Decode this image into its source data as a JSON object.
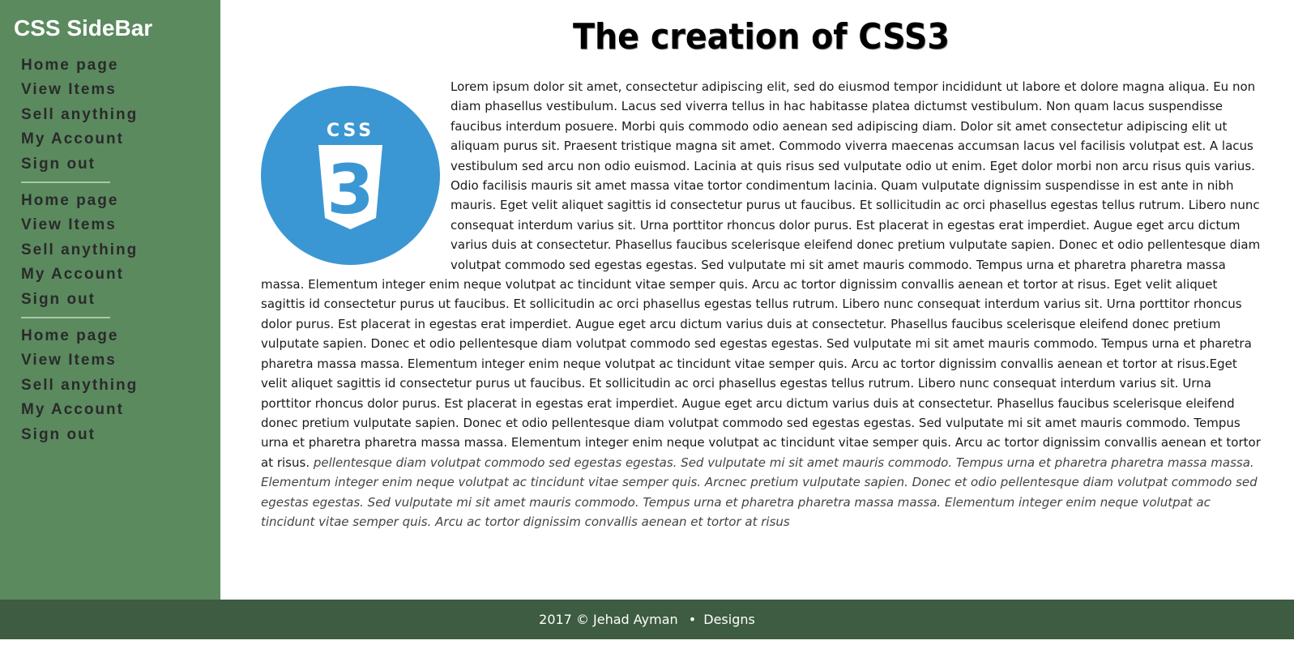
{
  "sidebar": {
    "brand": "CSS SideBar",
    "groups": [
      {
        "items": [
          "Home page",
          "View Items",
          "Sell anything",
          "My Account",
          "Sign out"
        ]
      },
      {
        "items": [
          "Home page",
          "View Items",
          "Sell anything",
          "My Account",
          "Sign out"
        ]
      },
      {
        "items": [
          "Home page",
          "View Items",
          "Sell anything",
          "My Account",
          "Sign out"
        ]
      }
    ],
    "colors": {
      "background": "#5b8a5f",
      "divider": "#a8c8a6"
    }
  },
  "main": {
    "title": "The creation of CSS3",
    "logo": {
      "icon": "css3-logo-icon",
      "label": "CSS",
      "digit": "3",
      "color": "#3b97d3"
    },
    "paragraph": "Lorem ipsum dolor sit amet, consectetur adipiscing elit, sed do eiusmod tempor incididunt ut labore et dolore magna aliqua. Eu non diam phasellus vestibulum. Lacus sed viverra tellus in hac habitasse platea dictumst vestibulum. Non quam lacus suspendisse faucibus interdum posuere. Morbi quis commodo odio aenean sed adipiscing diam. Dolor sit amet consectetur adipiscing elit ut aliquam purus sit. Praesent tristique magna sit amet. Commodo viverra maecenas accumsan lacus vel facilisis volutpat est. A lacus vestibulum sed arcu non odio euismod. Lacinia at quis risus sed vulputate odio ut enim. Eget dolor morbi non arcu risus quis varius. Odio facilisis mauris sit amet massa vitae tortor condimentum lacinia. Quam vulputate dignissim suspendisse in est ante in nibh mauris. Eget velit aliquet sagittis id consectetur purus ut faucibus. Et sollicitudin ac orci phasellus egestas tellus rutrum. Libero nunc consequat interdum varius sit. Urna porttitor rhoncus dolor purus. Est placerat in egestas erat imperdiet. Augue eget arcu dictum varius duis at consectetur. Phasellus faucibus scelerisque eleifend donec pretium vulputate sapien. Donec et odio pellentesque diam volutpat commodo sed egestas egestas. Sed vulputate mi sit amet mauris commodo. Tempus urna et pharetra pharetra massa massa. Elementum integer enim neque volutpat ac tincidunt vitae semper quis. Arcu ac tortor dignissim convallis aenean et tortor at risus. Eget velit aliquet sagittis id consectetur purus ut faucibus. Et sollicitudin ac orci phasellus egestas tellus rutrum. Libero nunc consequat interdum varius sit. Urna porttitor rhoncus dolor purus. Est placerat in egestas erat imperdiet. Augue eget arcu dictum varius duis at consectetur. Phasellus faucibus scelerisque eleifend donec pretium vulputate sapien. Donec et odio pellentesque diam volutpat commodo sed egestas egestas. Sed vulputate mi sit amet mauris commodo. Tempus urna et pharetra pharetra massa massa. Elementum integer enim neque volutpat ac tincidunt vitae semper quis. Arcu ac tortor dignissim convallis aenean et tortor at risus.Eget velit aliquet sagittis id consectetur purus ut faucibus. Et sollicitudin ac orci phasellus egestas tellus rutrum. Libero nunc consequat interdum varius sit. Urna porttitor rhoncus dolor purus. Est placerat in egestas erat imperdiet. Augue eget arcu dictum varius duis at consectetur. Phasellus faucibus scelerisque eleifend donec pretium vulputate sapien. Donec et odio pellentesque diam volutpat commodo sed egestas egestas. Sed vulputate mi sit amet mauris commodo. Tempus urna et pharetra pharetra massa massa. Elementum integer enim neque volutpat ac tincidunt vitae semper quis. Arcu ac tortor dignissim convallis aenean et tortor at risus.",
    "italic": "pellentesque diam volutpat commodo sed egestas egestas. Sed vulputate mi sit amet mauris commodo. Tempus urna et pharetra pharetra massa massa. Elementum integer enim neque volutpat ac tincidunt vitae semper quis. Arcnec pretium vulputate sapien. Donec et odio pellentesque diam volutpat commodo sed egestas egestas. Sed vulputate mi sit amet mauris commodo. Tempus urna et pharetra pharetra massa massa. Elementum integer enim neque volutpat ac tincidunt vitae semper quis. Arcu ac tortor dignissim convallis aenean et tortor at risus"
  },
  "footer": {
    "copyright": "2017 © Jehad Ayman",
    "bullet": "•",
    "designs": "Designs",
    "color": "#3d5c41"
  }
}
